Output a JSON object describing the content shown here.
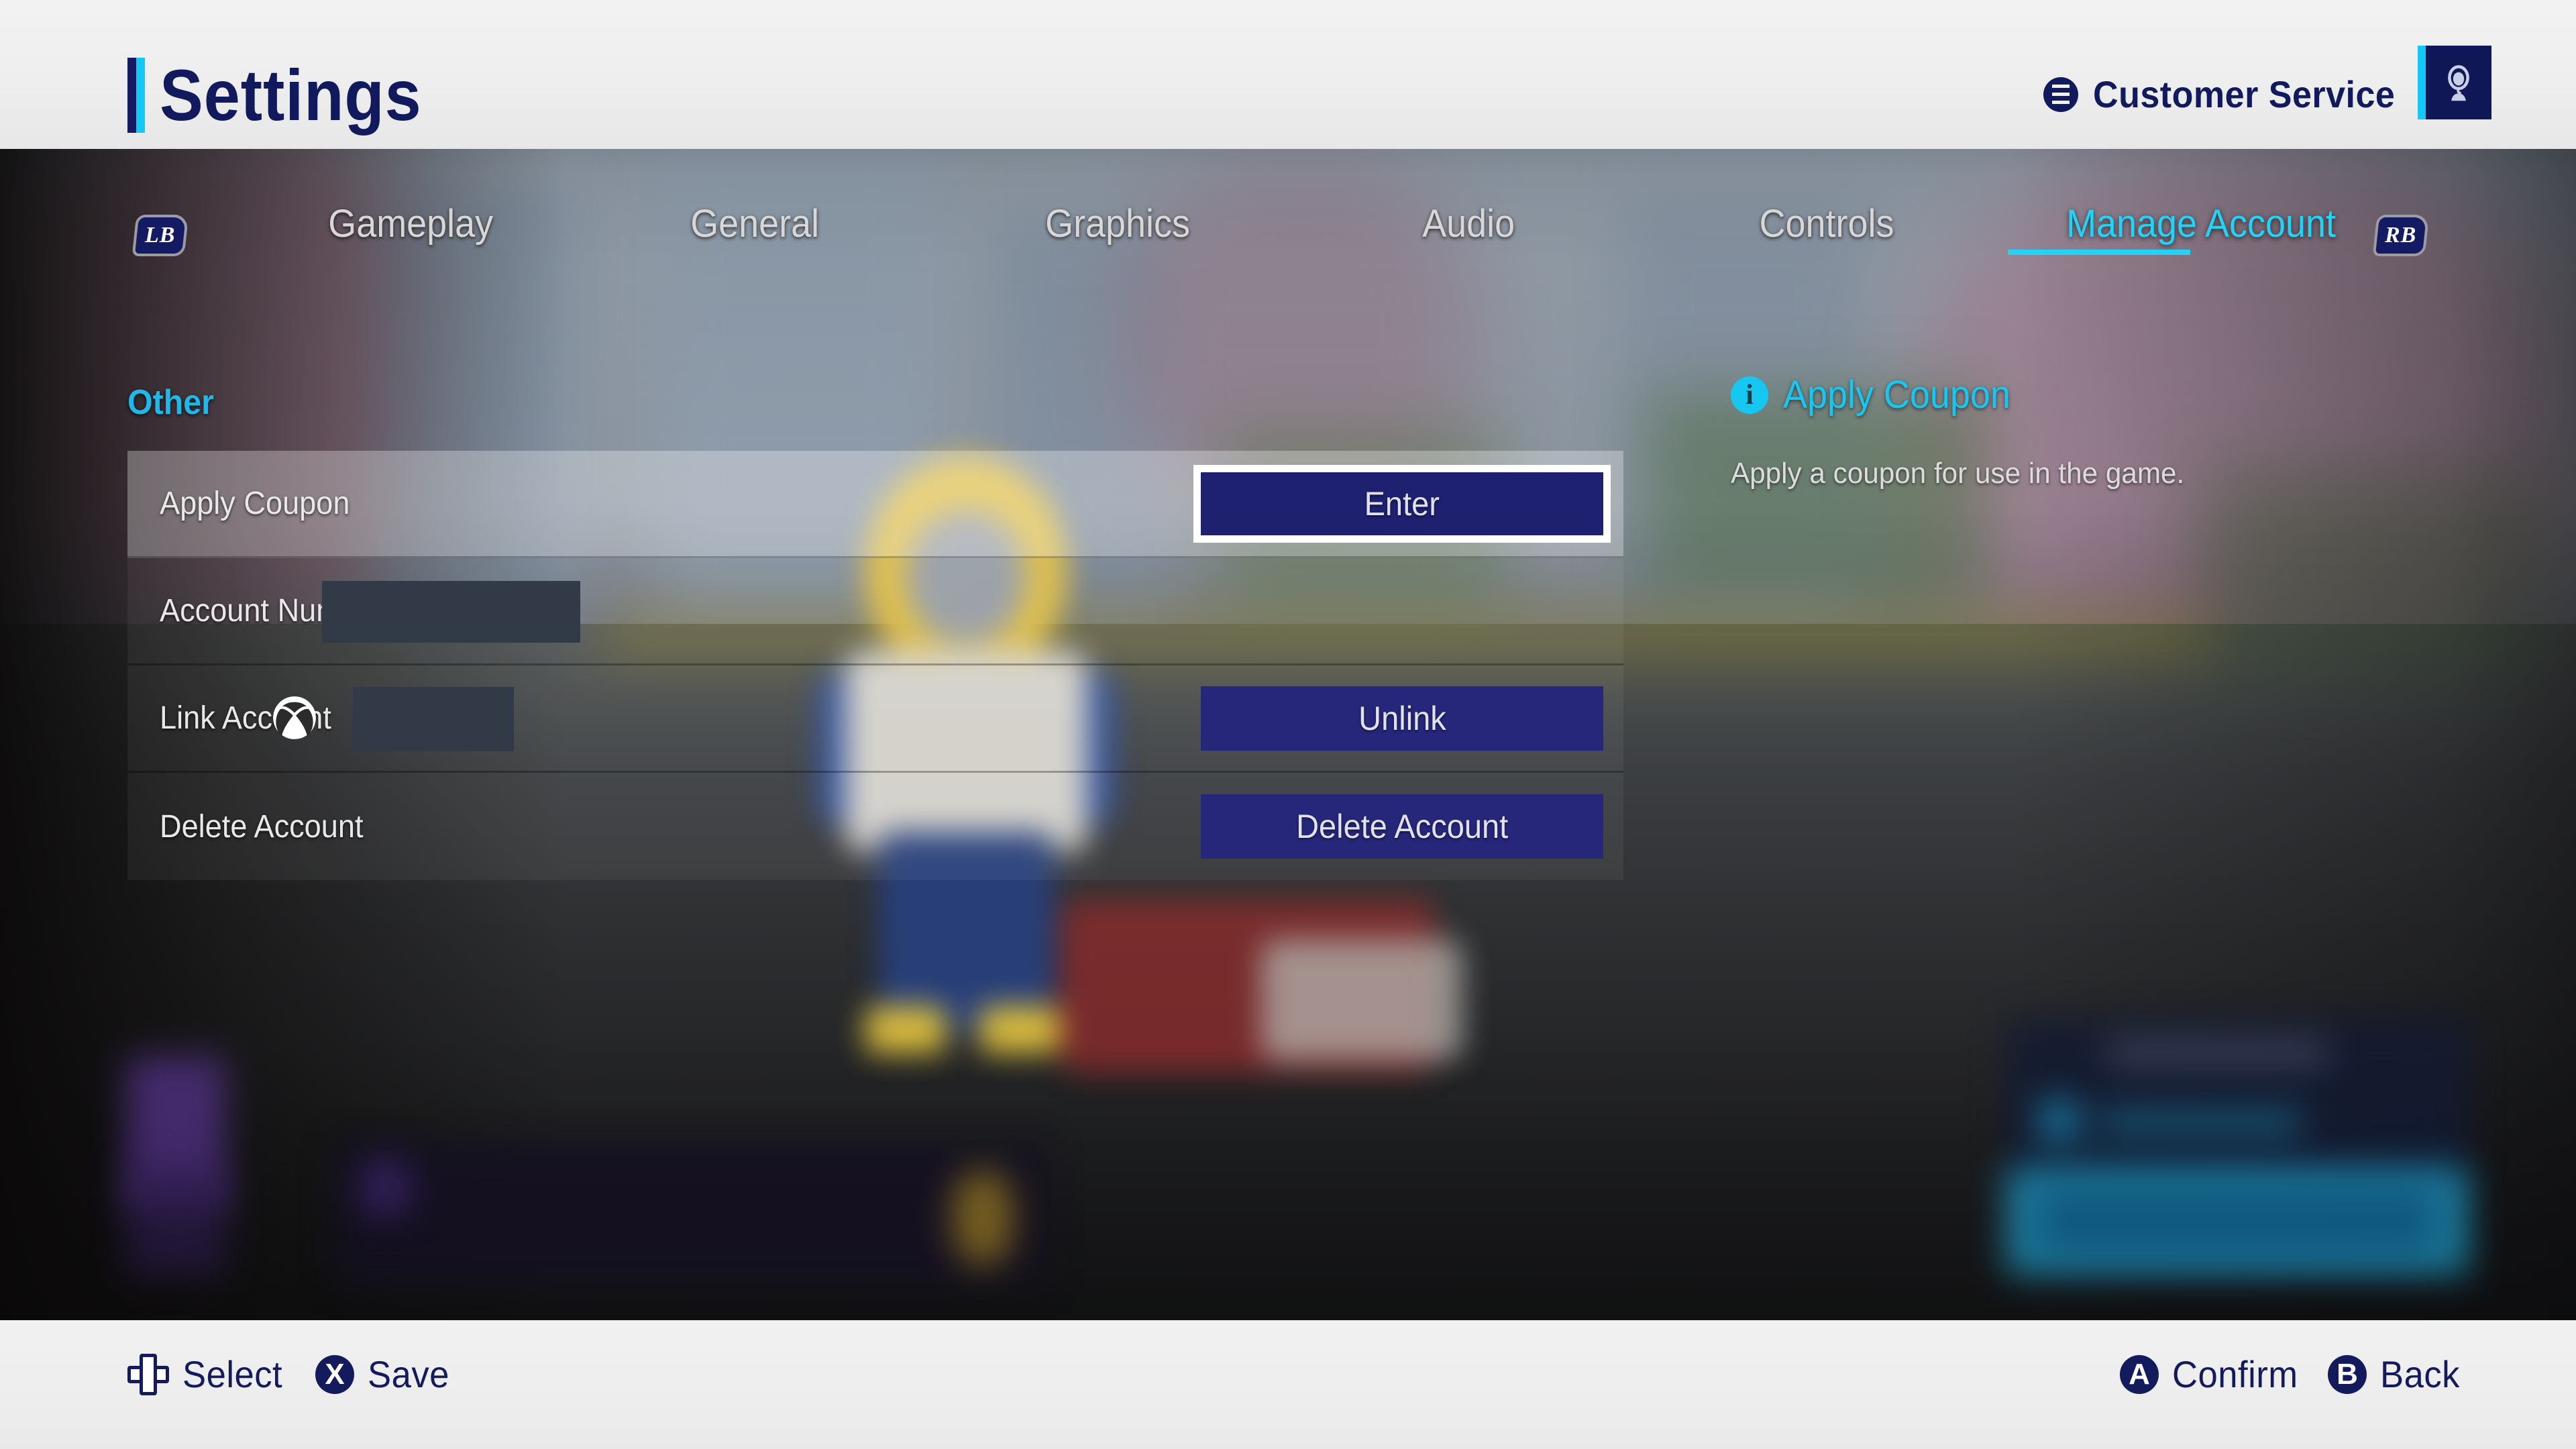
{
  "header": {
    "title": "Settings",
    "customer_service_label": "Customer Service",
    "customer_service_icon": "menu-lines-icon",
    "customer_service_button_icon": "headset-icon"
  },
  "tabs": {
    "left_bumper": "LB",
    "right_bumper": "RB",
    "items": [
      {
        "label": "Gameplay",
        "active": false
      },
      {
        "label": "General",
        "active": false
      },
      {
        "label": "Graphics",
        "active": false
      },
      {
        "label": "Audio",
        "active": false
      },
      {
        "label": "Controls",
        "active": false
      },
      {
        "label": "Manage Account",
        "active": true
      }
    ]
  },
  "main": {
    "section_label": "Other",
    "rows": [
      {
        "label": "Apply Coupon",
        "action_label": "Enter",
        "selected": true,
        "focused_action": true,
        "has_redaction": false,
        "has_platform_icon": false
      },
      {
        "label": "Account Number",
        "action_label": "",
        "selected": false,
        "focused_action": false,
        "has_redaction": true,
        "has_platform_icon": false
      },
      {
        "label": "Link Account",
        "action_label": "Unlink",
        "selected": false,
        "focused_action": false,
        "has_redaction": true,
        "has_platform_icon": true,
        "platform_icon": "xbox-icon"
      },
      {
        "label": "Delete Account",
        "action_label": "Delete Account",
        "selected": false,
        "focused_action": false,
        "has_redaction": false,
        "has_platform_icon": false
      }
    ]
  },
  "info_panel": {
    "icon": "info-icon",
    "icon_glyph": "i",
    "title": "Apply Coupon",
    "description": "Apply a coupon for use in the game."
  },
  "bottom_bar": {
    "prompts": [
      {
        "glyph": "dpad-icon",
        "glyph_text": "",
        "label": "Select"
      },
      {
        "glyph": "x-button-icon",
        "glyph_text": "X",
        "label": "Save"
      },
      {
        "glyph": "a-button-icon",
        "glyph_text": "A",
        "label": "Confirm"
      },
      {
        "glyph": "b-button-icon",
        "glyph_text": "B",
        "label": "Back"
      }
    ]
  },
  "colors": {
    "accent_cyan": "#22d3f7",
    "brand_navy": "#141b5c",
    "button_navy": "#26267a",
    "button_focus_navy": "#1e2070",
    "header_bg": "#efefef",
    "redaction_gray": "#323a47",
    "text_light": "#e8e8e8"
  }
}
